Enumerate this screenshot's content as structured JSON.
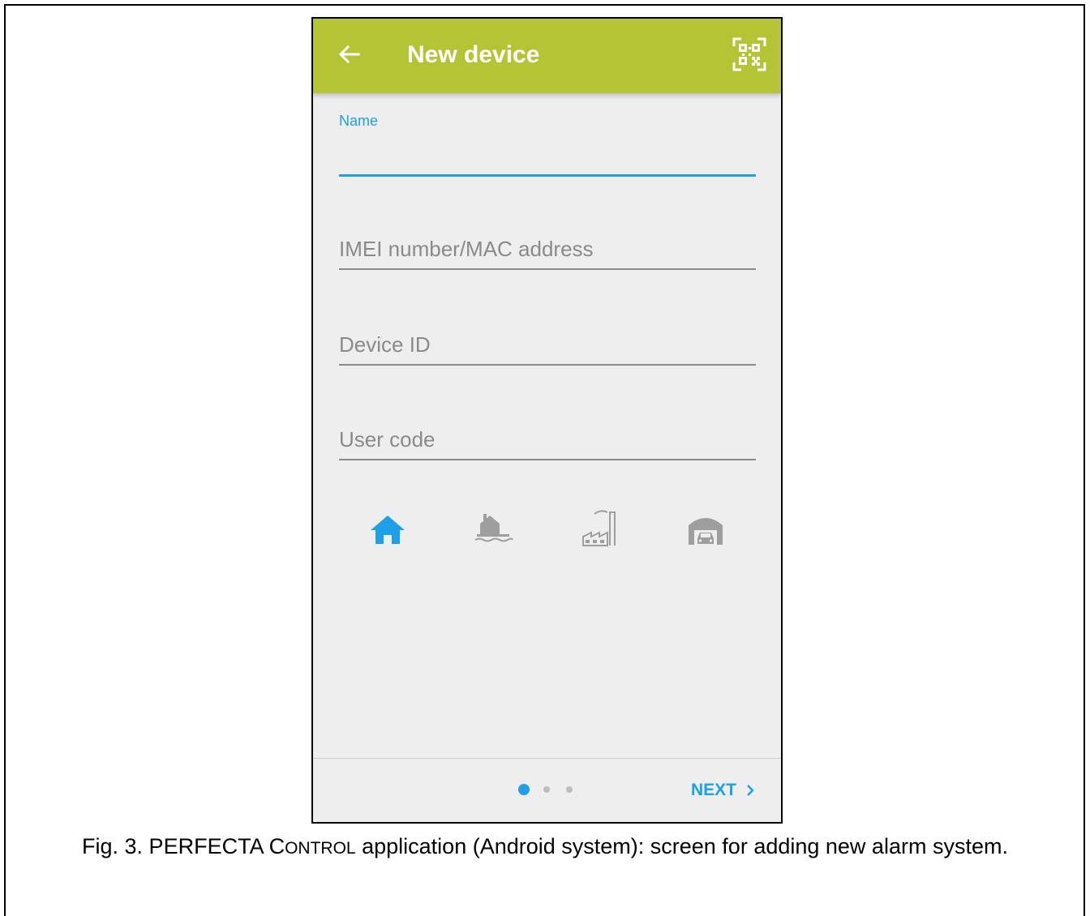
{
  "appbar": {
    "title": "New device",
    "back_icon": "arrow-left-icon",
    "qr_icon": "qr-code-scan-icon",
    "color": "#b5c435"
  },
  "form": {
    "name_label": "Name",
    "name_value": "",
    "imei_placeholder": "IMEI number/MAC address",
    "device_id_placeholder": "Device ID",
    "user_code_placeholder": "User code"
  },
  "object_types": [
    {
      "icon": "house-icon",
      "selected": true
    },
    {
      "icon": "house-by-water-icon",
      "selected": false
    },
    {
      "icon": "factory-icon",
      "selected": false
    },
    {
      "icon": "garage-car-icon",
      "selected": false
    }
  ],
  "pager": {
    "pages": 3,
    "current": 1
  },
  "footer": {
    "next_label": "NEXT",
    "next_icon": "chevron-right-icon"
  },
  "caption": {
    "part1": "Fig. 3. PERFECTA C",
    "part2": "ONTROL",
    "part3": " application (Android system): screen for adding new alarm system."
  },
  "colors": {
    "accent": "#1ea0e8",
    "inactive": "#9e9e9e",
    "background": "#eeeeee"
  }
}
